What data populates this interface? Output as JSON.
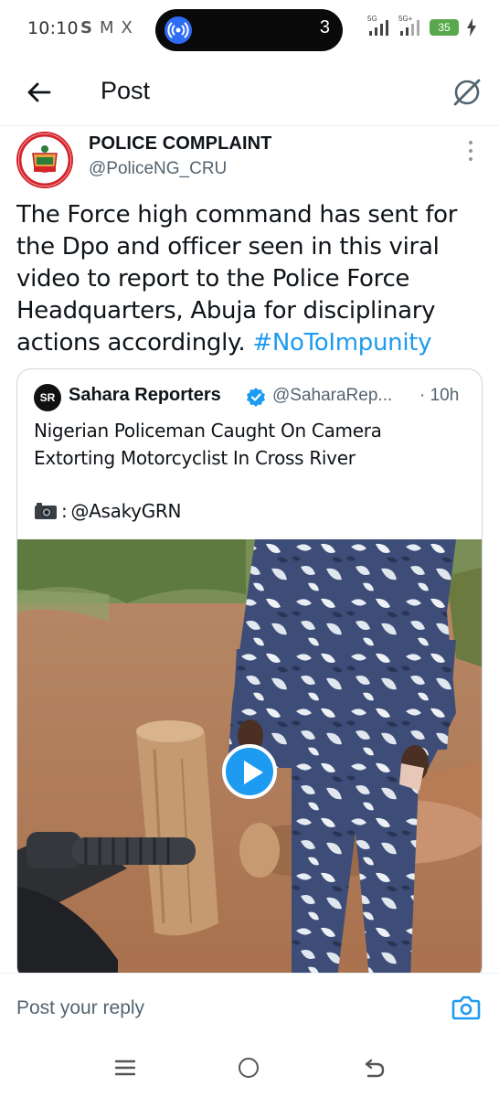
{
  "status_bar": {
    "time": "10:10",
    "left_icons": [
      "S",
      "M",
      "X"
    ],
    "notification_count": "3",
    "network_1": "5G",
    "network_2": "5G+",
    "battery": "35"
  },
  "header": {
    "title": "Post"
  },
  "post": {
    "author_name": "POLICE COMPLAINT",
    "author_handle": "@PoliceNG_CRU",
    "text": "The Force high command has sent for the Dpo and officer seen in this viral video to report to the Police Force Headquarters, Abuja for disciplinary actions accordingly. ",
    "hashtag": "#NoToImpunity"
  },
  "quoted_post": {
    "avatar_text": "SR",
    "author_name": "Sahara Reporters",
    "author_handle": "@SaharaRep...",
    "time": "· 10h",
    "text": "Nigerian Policeman Caught On Camera Extorting Motorcyclist In Cross River",
    "credit_suffix": ":",
    "credit": "@AsakyGRN"
  },
  "reply": {
    "placeholder": "Post your reply"
  },
  "colors": {
    "accent": "#1d9bf0",
    "text": "#0f1419",
    "secondary": "#536471"
  }
}
